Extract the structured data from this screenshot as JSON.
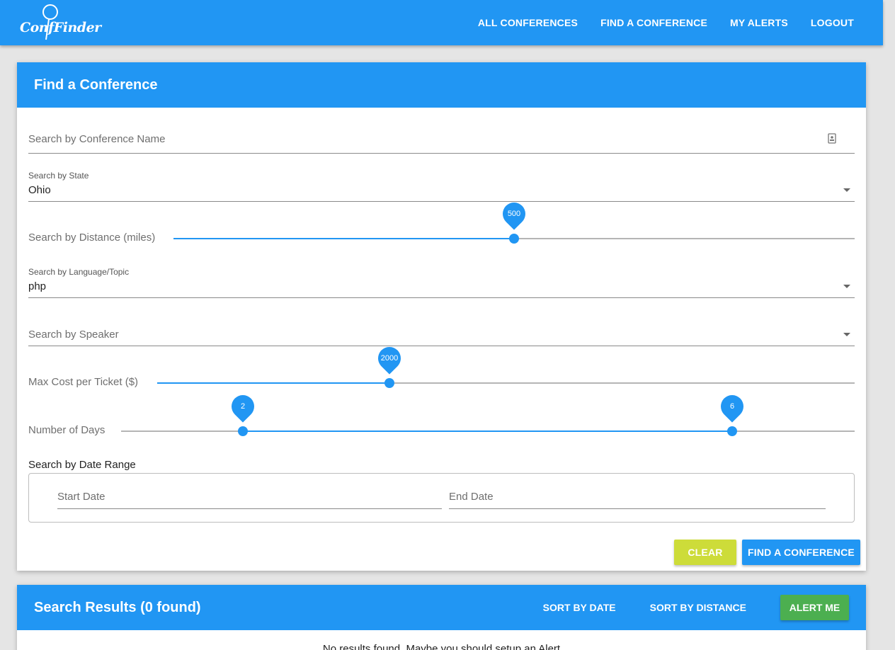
{
  "app": {
    "logo_text": "ConfFinder"
  },
  "nav": {
    "items": [
      "ALL CONFERENCES",
      "FIND A CONFERENCE",
      "MY ALERTS",
      "LOGOUT"
    ]
  },
  "search_card": {
    "title": "Find a Conference",
    "name_field": {
      "placeholder": "Search by Conference Name",
      "value": ""
    },
    "state_field": {
      "label": "Search by State",
      "value": "Ohio"
    },
    "distance_slider": {
      "label": "Search by Distance (miles)",
      "value": "500",
      "fraction": 0.5
    },
    "topic_field": {
      "label": "Search by Language/Topic",
      "value": "php"
    },
    "speaker_field": {
      "placeholder": "Search by Speaker",
      "value": ""
    },
    "cost_slider": {
      "label": "Max Cost per Ticket ($)",
      "value": "2000",
      "fraction": 0.333
    },
    "days_slider": {
      "label": "Number of Days",
      "low": "2",
      "high": "6",
      "low_fraction": 0.166,
      "high_fraction": 0.833
    },
    "date_range": {
      "heading": "Search by Date Range",
      "start_placeholder": "Start Date",
      "end_placeholder": "End Date"
    },
    "clear_label": "CLEAR",
    "submit_label": "FIND A CONFERENCE",
    "colors": {
      "primary": "#2196f3",
      "clear": "#cddc39",
      "alert": "#4caf50"
    }
  },
  "results_card": {
    "title": "Search Results (0 found)",
    "sort_date_label": "SORT BY DATE",
    "sort_distance_label": "SORT BY DISTANCE",
    "alert_label": "ALERT ME",
    "empty_message": "No results found. Maybe you should setup an Alert"
  },
  "icons": {
    "name_field_icon": "contact-card-icon",
    "dropdown": "chevron-down-icon"
  }
}
